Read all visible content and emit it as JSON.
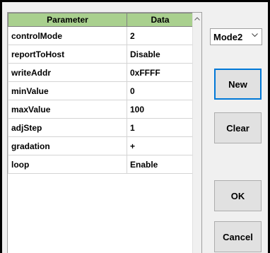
{
  "mode_select": {
    "value": "Mode2"
  },
  "grid": {
    "columns": [
      "Parameter",
      "Data"
    ],
    "rows": [
      {
        "param": "controlMode",
        "data": "2"
      },
      {
        "param": "reportToHost",
        "data": "Disable"
      },
      {
        "param": "writeAddr",
        "data": "0xFFFF"
      },
      {
        "param": "minValue",
        "data": "0"
      },
      {
        "param": "maxValue",
        "data": "100"
      },
      {
        "param": "adjStep",
        "data": "1"
      },
      {
        "param": "gradation",
        "data": "+"
      },
      {
        "param": "loop",
        "data": "Enable"
      }
    ]
  },
  "buttons": {
    "new": "New",
    "clear": "Clear",
    "ok": "OK",
    "cancel": "Cancel"
  },
  "colors": {
    "header_bg": "#a9d08e",
    "focus_border": "#0078d7"
  },
  "icons": {
    "scroll_up": "chevron-up-icon",
    "dropdown": "chevron-down-icon"
  }
}
